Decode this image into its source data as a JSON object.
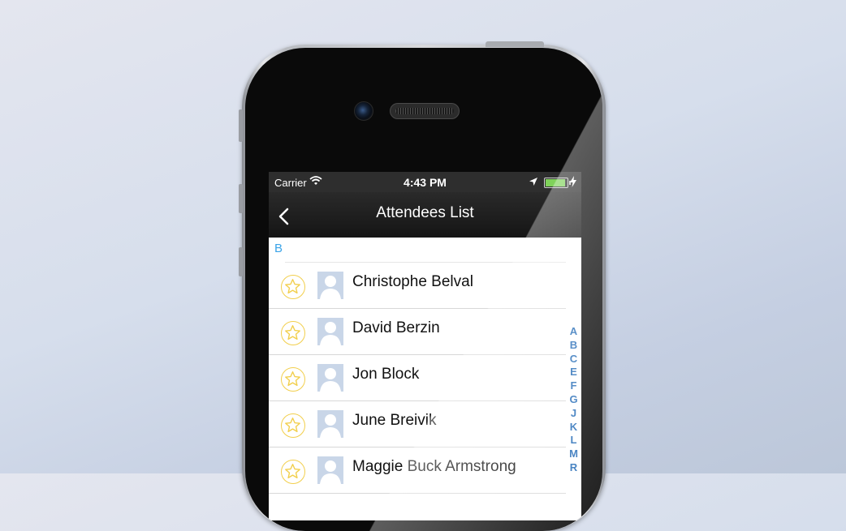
{
  "status_bar": {
    "carrier": "Carrier",
    "time": "4:43 PM"
  },
  "nav": {
    "title": "Attendees List"
  },
  "section": {
    "letter": "B"
  },
  "attendees": [
    {
      "name": "Christophe Belval"
    },
    {
      "name": "David Berzin"
    },
    {
      "name": "Jon Block"
    },
    {
      "name": "June Breivik"
    },
    {
      "name": "Maggie Buck Armstrong"
    }
  ],
  "index_letters": [
    "A",
    "B",
    "C",
    "E",
    "F",
    "G",
    "J",
    "K",
    "L",
    "M",
    "R"
  ],
  "colors": {
    "section_letter": "#3ba4e8",
    "index_letter": "#2a6fb8",
    "star_outline": "#f2cf4c",
    "battery": "#7fd25a"
  },
  "icons": {
    "wifi": "wifi-icon",
    "location": "location-arrow-icon",
    "battery": "battery-icon",
    "charging": "charging-bolt-icon",
    "back": "back-chevron-icon",
    "favorite": "star-icon",
    "avatar": "avatar-placeholder-icon"
  }
}
